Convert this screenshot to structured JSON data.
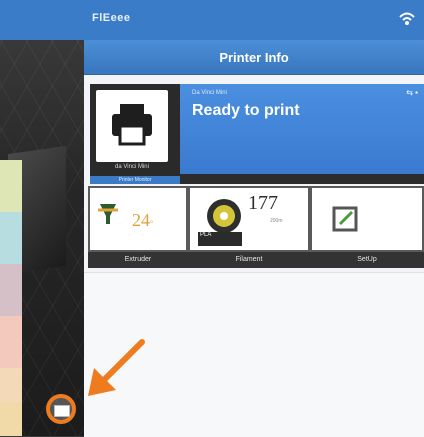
{
  "app": {
    "brand": "FlEeee"
  },
  "panel": {
    "title": "Printer Info"
  },
  "printer": {
    "model": "Da Vinci Mini",
    "status": "Ready to print",
    "thumb_label": "da Vinci Mini",
    "thumb_caption": "Printer Monitor"
  },
  "tiles": {
    "extruder": {
      "label": "Extruder",
      "temp": "24",
      "unit": "°"
    },
    "filament": {
      "label": "Filament",
      "value": "177",
      "sub": "200m",
      "type": "PLA"
    },
    "setup": {
      "label": "SetUp"
    }
  },
  "colors": {
    "accent": "#3a7cc8",
    "highlight": "#ef7b1f",
    "strip": [
      "#dfe6b5",
      "#b8dde0",
      "#d6c0c8",
      "#f2c9bc",
      "#f3d9b8",
      "#f1d9a8"
    ]
  },
  "icons": {
    "printer": "printer-icon",
    "nozzle": "nozzle-icon",
    "filament": "filament-spool-icon",
    "setup": "setup-icon",
    "wifi": "wifi-icon",
    "arrow": "arrow-icon",
    "add": "add-icon"
  }
}
